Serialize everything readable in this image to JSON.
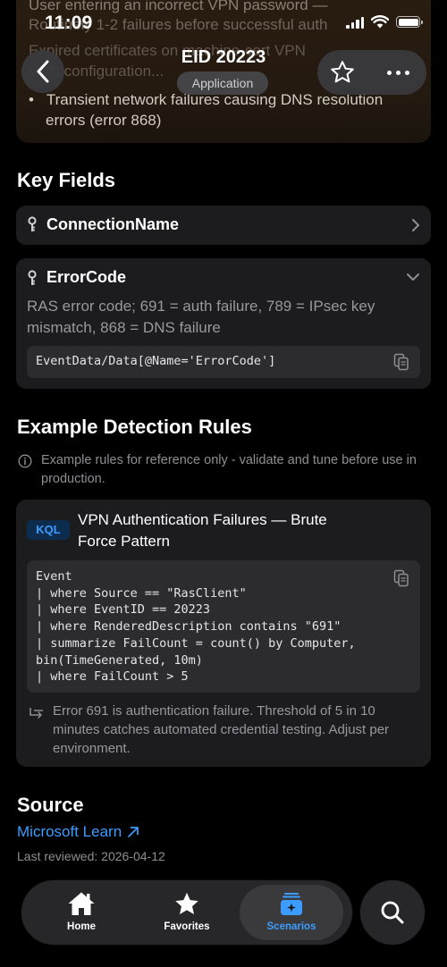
{
  "status_bar": {
    "time": "11:09"
  },
  "nav": {
    "title": "EID 20223",
    "badge": "Application",
    "back_icon": "chevron-left-icon",
    "favorite_icon": "star-icon",
    "more_icon": "ellipsis-icon"
  },
  "warning_card": {
    "lines_faded": [
      "User entering an incorrect VPN password —",
      "Routinely 1-2 failures before successful auth",
      "Expired certificates on machine-cert VPN",
      "VPN configuration..."
    ],
    "bullet": "•",
    "last_item": [
      "Transient network failures causing DNS resolution",
      "errors (error 868)"
    ]
  },
  "key_fields": {
    "heading": "Key Fields",
    "items": [
      {
        "name": "ConnectionName",
        "expanded": false
      },
      {
        "name": "ErrorCode",
        "expanded": true,
        "description": "RAS error code; 691 = auth failure, 789 = IPsec key mismatch, 868 = DNS failure",
        "xpath": "EventData/Data[@Name='ErrorCode']"
      }
    ]
  },
  "detection": {
    "heading": "Example Detection Rules",
    "note": "Example rules for reference only - validate and tune before use in production.",
    "rules": [
      {
        "language": "KQL",
        "title": "VPN Authentication Failures — Brute Force Pattern",
        "query_lines": [
          "Event",
          "| where Source == \"RasClient\"",
          "| where EventID == 20223",
          "| where RenderedDescription contains \"691\"",
          "| summarize FailCount = count() by Computer,",
          "bin(TimeGenerated, 10m)",
          "| where FailCount > 5"
        ],
        "explanation": "Error 691 is authentication failure. Threshold of 5 in 10 minutes catches automated credential testing. Adjust per environment."
      }
    ]
  },
  "source": {
    "heading": "Source",
    "link_text": "Microsoft Learn",
    "reviewed": "Last reviewed: 2026-04-12"
  },
  "tab_bar": {
    "tabs": [
      {
        "label": "Home",
        "icon": "house-icon",
        "active": false
      },
      {
        "label": "Favorites",
        "icon": "star-icon",
        "active": false
      },
      {
        "label": "Scenarios",
        "icon": "scenarios-icon",
        "active": true
      }
    ],
    "search_icon": "magnifying-glass-icon"
  },
  "colors": {
    "background": "#000000",
    "card": "#1c1c1e",
    "code_bg": "#2c2c2e",
    "accent": "#3d9cff",
    "secondary_text": "#98989d"
  }
}
